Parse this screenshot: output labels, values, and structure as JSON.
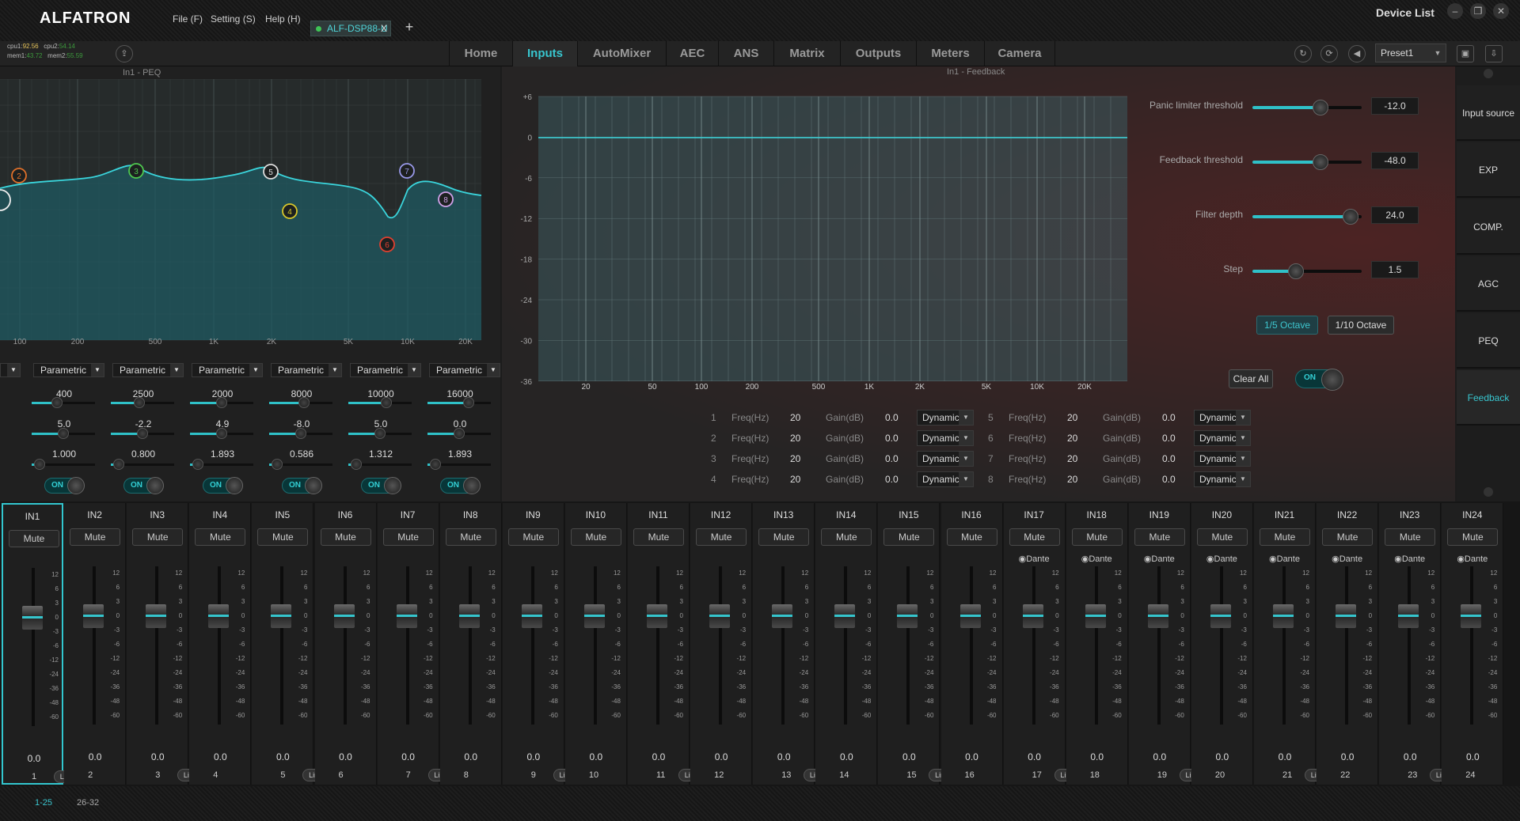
{
  "app": {
    "logo": "ALFATRON",
    "device_list_label": "Device List"
  },
  "menu": [
    "File (F)",
    "Setting (S)",
    "Help (H)"
  ],
  "device_tab": {
    "label": "ALF-DSP88-U",
    "close": "X",
    "add": "+"
  },
  "status": {
    "cpu1_label": "cpu1:",
    "cpu1": "92.56",
    "cpu2_label": "cpu2:",
    "cpu2": "54.14",
    "mem1_label": "mem1:",
    "mem1": "43.72",
    "mem2_label": "mem2:",
    "mem2": "55.59"
  },
  "nav_tabs": [
    "Home",
    "Inputs",
    "AutoMixer",
    "AEC",
    "ANS",
    "Matrix",
    "Outputs",
    "Meters",
    "Camera"
  ],
  "active_tab": "Inputs",
  "preset": "Preset1",
  "peq": {
    "title": "In1 - PEQ",
    "freq_labels": [
      "100",
      "200",
      "500",
      "1K",
      "2K",
      "5K",
      "10K",
      "20K"
    ],
    "nodes": [
      "2",
      "3",
      "4",
      "5",
      "6",
      "7",
      "8"
    ],
    "bands": [
      {
        "type": "Parametric",
        "freq": "400",
        "gain": "5.0",
        "q": "1.000",
        "toggle": "ON"
      },
      {
        "type": "Parametric",
        "freq": "2500",
        "gain": "-2.2",
        "q": "0.800",
        "toggle": "ON"
      },
      {
        "type": "Parametric",
        "freq": "2000",
        "gain": "4.9",
        "q": "1.893",
        "toggle": "ON"
      },
      {
        "type": "Parametric",
        "freq": "8000",
        "gain": "-8.0",
        "q": "0.586",
        "toggle": "ON"
      },
      {
        "type": "Parametric",
        "freq": "10000",
        "gain": "5.0",
        "q": "1.312",
        "toggle": "ON"
      },
      {
        "type": "Parametric",
        "freq": "16000",
        "gain": "0.0",
        "q": "1.893",
        "toggle": "ON"
      }
    ]
  },
  "feedback": {
    "title": "In1 - Feedback",
    "y_labels": [
      "+6",
      "0",
      "-6",
      "-12",
      "-18",
      "-24",
      "-30",
      "-36"
    ],
    "x_labels": [
      "20",
      "50",
      "100",
      "200",
      "500",
      "1K",
      "2K",
      "5K",
      "10K",
      "20K"
    ],
    "params": [
      {
        "label": "Panic limiter threshold",
        "value": "-12.0",
        "level": 0.62
      },
      {
        "label": "Feedback threshold",
        "value": "-48.0",
        "level": 0.62
      },
      {
        "label": "Filter depth",
        "value": "24.0",
        "level": 0.9
      },
      {
        "label": "Step",
        "value": "1.5",
        "level": 0.4
      }
    ],
    "octave_buttons": [
      "1/5 Octave",
      "1/10 Octave"
    ],
    "selected_octave": "1/5 Octave",
    "clear_all": "Clear All",
    "toggle": "ON",
    "freq_label": "Freq(Hz)",
    "gain_label": "Gain(dB)",
    "filters": [
      {
        "n": "1",
        "freq": "20",
        "gain": "0.0",
        "mode": "Dynamic"
      },
      {
        "n": "2",
        "freq": "20",
        "gain": "0.0",
        "mode": "Dynamic"
      },
      {
        "n": "3",
        "freq": "20",
        "gain": "0.0",
        "mode": "Dynamic"
      },
      {
        "n": "4",
        "freq": "20",
        "gain": "0.0",
        "mode": "Dynamic"
      },
      {
        "n": "5",
        "freq": "20",
        "gain": "0.0",
        "mode": "Dynamic"
      },
      {
        "n": "6",
        "freq": "20",
        "gain": "0.0",
        "mode": "Dynamic"
      },
      {
        "n": "7",
        "freq": "20",
        "gain": "0.0",
        "mode": "Dynamic"
      },
      {
        "n": "8",
        "freq": "20",
        "gain": "0.0",
        "mode": "Dynamic"
      }
    ]
  },
  "side_menu": [
    "Input source",
    "EXP",
    "COMP.",
    "AGC",
    "PEQ",
    "Feedback"
  ],
  "side_active": "Feedback",
  "channels": {
    "mute_label": "Mute",
    "link_label": "Link",
    "dante_label": "Dante",
    "value": "0.0",
    "scale": [
      "12",
      "6",
      "3",
      "0",
      "-3",
      "-6",
      "-12",
      "-24",
      "-36",
      "-48",
      "-60"
    ],
    "names": [
      "IN1",
      "IN2",
      "IN3",
      "IN4",
      "IN5",
      "IN6",
      "IN7",
      "IN8",
      "IN9",
      "IN10",
      "IN11",
      "IN12",
      "IN13",
      "IN14",
      "IN15",
      "IN16",
      "IN17",
      "IN18",
      "IN19",
      "IN20",
      "IN21",
      "IN22",
      "IN23",
      "IN24"
    ]
  },
  "pages": [
    "1-25",
    "26-32"
  ],
  "colors": {
    "accent": "#35c5cd",
    "brand_bg": "#1c1c1c"
  }
}
